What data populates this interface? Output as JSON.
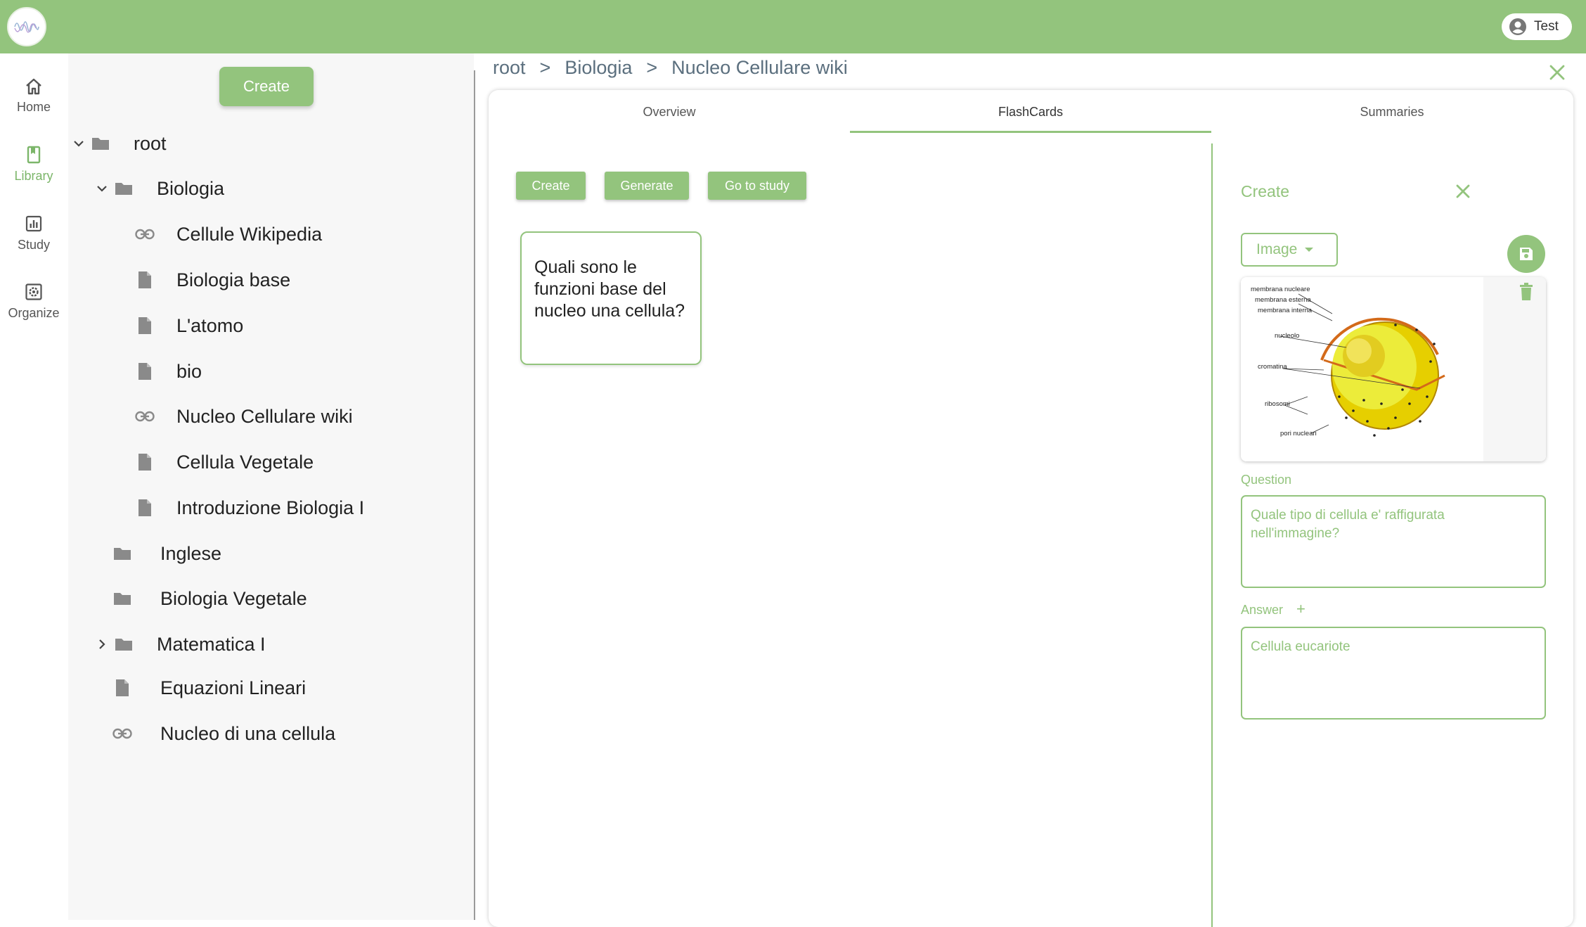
{
  "topbar": {
    "user_label": "Test",
    "icons": {
      "logo": "wave-logo-icon",
      "user": "account-circle-icon"
    }
  },
  "colors": {
    "accent": "#93c47d",
    "breadcrumb": "#5b6f7e"
  },
  "rail": {
    "items": [
      {
        "label": "Home",
        "icon": "home-icon"
      },
      {
        "label": "Library",
        "icon": "book-icon",
        "active": true
      },
      {
        "label": "Study",
        "icon": "chart-icon"
      },
      {
        "label": "Organize",
        "icon": "settings-box-icon"
      }
    ]
  },
  "tree": {
    "create_label": "Create",
    "items": [
      {
        "label": "root",
        "kind": "folder",
        "expanded": true
      },
      {
        "label": "Biologia",
        "kind": "folder",
        "expanded": true
      },
      {
        "label": "Cellule Wikipedia",
        "kind": "link"
      },
      {
        "label": "Biologia base",
        "kind": "file"
      },
      {
        "label": "L'atomo",
        "kind": "file"
      },
      {
        "label": "bio",
        "kind": "file"
      },
      {
        "label": "Nucleo Cellulare wiki",
        "kind": "link"
      },
      {
        "label": "Cellula Vegetale",
        "kind": "file"
      },
      {
        "label": "Introduzione Biologia I",
        "kind": "file"
      },
      {
        "label": "Inglese",
        "kind": "folder"
      },
      {
        "label": "Biologia Vegetale",
        "kind": "folder"
      },
      {
        "label": "Matematica I",
        "kind": "folder",
        "expanded": false
      },
      {
        "label": "Equazioni Lineari",
        "kind": "file"
      },
      {
        "label": "Nucleo di una cellula",
        "kind": "link"
      }
    ]
  },
  "breadcrumb": {
    "parts": [
      "root",
      "Biologia",
      "Nucleo Cellulare wiki"
    ],
    "separator": ">"
  },
  "tabs": [
    {
      "label": "Overview"
    },
    {
      "label": "FlashCards",
      "active": true
    },
    {
      "label": "Summaries"
    }
  ],
  "flashcards": {
    "buttons": {
      "create": "Create",
      "generate": "Generate",
      "study": "Go to study"
    },
    "cards": [
      {
        "question": "Quali sono le funzioni base del nucleo una cellula?"
      }
    ]
  },
  "editor": {
    "title": "Create",
    "type_value": "Image",
    "image_labels": [
      "membrana nucleare",
      "membrana esterna",
      "membrana interna",
      "nucleolo",
      "cromatina",
      "ribosomi",
      "pori nucleari"
    ],
    "question_label": "Question",
    "question_value": "Quale tipo di cellula e' raffigurata nell'immagine?",
    "answer_label": "Answer",
    "answer_add": "+",
    "answer_value": "Cellula eucariote"
  }
}
